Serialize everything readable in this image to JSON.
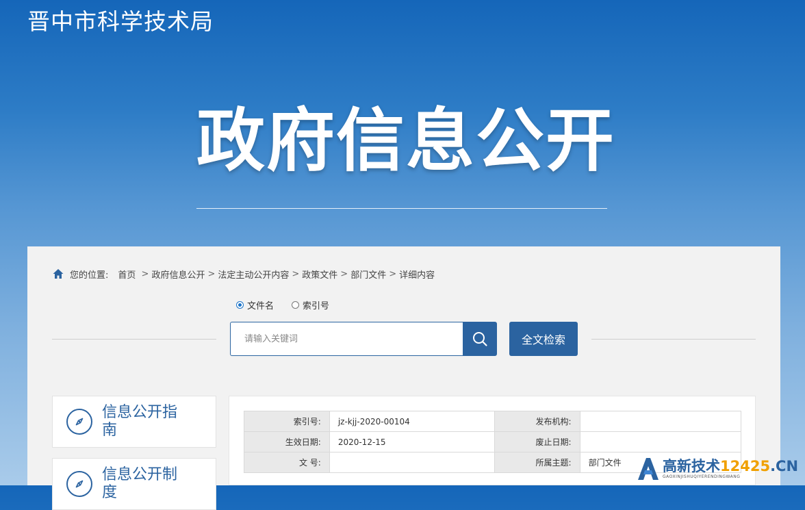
{
  "header": {
    "site_title": "晋中市科学技术局",
    "hero_title": "政府信息公开"
  },
  "breadcrumb": {
    "label": "您的位置:",
    "items": [
      "首页",
      "政府信息公开",
      "法定主动公开内容",
      "政策文件",
      "部门文件",
      "详细内容"
    ]
  },
  "search": {
    "options": [
      "文件名",
      "索引号"
    ],
    "selected": "文件名",
    "placeholder": "请输入关键词",
    "fulltext_label": "全文检索"
  },
  "sidebar": {
    "items": [
      {
        "label": "信息公开指南",
        "icon": "compass-icon"
      },
      {
        "label": "信息公开制度",
        "icon": "compass-icon"
      }
    ]
  },
  "meta_table": {
    "rows": [
      {
        "k1": "索引号:",
        "v1": "jz-kjj-2020-00104",
        "k2": "发布机构:",
        "v2": ""
      },
      {
        "k1": "生效日期:",
        "v1": "2020-12-15",
        "k2": "废止日期:",
        "v2": ""
      },
      {
        "k1": "文 号:",
        "v1": "",
        "k2": "所属主题:",
        "v2": "部门文件"
      }
    ]
  },
  "watermark": {
    "text_main": "高新技术",
    "text_num": "12425",
    "text_cn": ".CN",
    "text_sub": "GAOXINJISHUQIYERENDINGWANG"
  },
  "colors": {
    "primary": "#2b63a0",
    "header_top": "#1566b9",
    "panel_bg": "#f2f2f2"
  }
}
